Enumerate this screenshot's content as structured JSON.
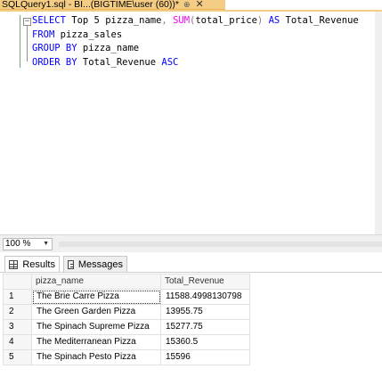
{
  "document_tab": {
    "title": "SQLQuery1.sql - BI...(BIGTIME\\user (60))*",
    "pin_glyph": "⊕",
    "close_glyph": "✕"
  },
  "editor": {
    "outline_toggle": "−",
    "lines": [
      [
        {
          "t": "SELECT",
          "c": "kw"
        },
        {
          "t": " Top 5 pizza_name",
          "c": "id"
        },
        {
          "t": ",",
          "c": "op"
        },
        {
          "t": " ",
          "c": "id"
        },
        {
          "t": "SUM",
          "c": "fn"
        },
        {
          "t": "(",
          "c": "op"
        },
        {
          "t": "total_price",
          "c": "id"
        },
        {
          "t": ")",
          "c": "op"
        },
        {
          "t": " ",
          "c": "id"
        },
        {
          "t": "AS",
          "c": "kw"
        },
        {
          "t": " Total_Revenue",
          "c": "id"
        }
      ],
      [
        {
          "t": "FROM",
          "c": "kw"
        },
        {
          "t": " pizza_sales",
          "c": "id"
        }
      ],
      [
        {
          "t": "GROUP BY",
          "c": "kw"
        },
        {
          "t": " pizza_name",
          "c": "id"
        }
      ],
      [
        {
          "t": "ORDER BY",
          "c": "kw"
        },
        {
          "t": " Total_Revenue ",
          "c": "id"
        },
        {
          "t": "ASC",
          "c": "kw"
        }
      ]
    ]
  },
  "zoom": {
    "value": "100 %",
    "arrow": "▼"
  },
  "result_tabs": {
    "results_label": "Results",
    "messages_label": "Messages"
  },
  "grid": {
    "columns": [
      "pizza_name",
      "Total_Revenue"
    ],
    "rows": [
      {
        "num": "1",
        "pizza_name": "The Brie Carre Pizza",
        "total_revenue": "11588.4998130798"
      },
      {
        "num": "2",
        "pizza_name": "The Green Garden Pizza",
        "total_revenue": "13955.75"
      },
      {
        "num": "3",
        "pizza_name": "The Spinach Supreme Pizza",
        "total_revenue": "15277.75"
      },
      {
        "num": "4",
        "pizza_name": "The Mediterranean Pizza",
        "total_revenue": "15360.5"
      },
      {
        "num": "5",
        "pizza_name": "The Spinach Pesto Pizza",
        "total_revenue": "15596"
      }
    ]
  },
  "colors": {
    "tab_accent": "#f5cc84",
    "keyword": "#0000ff",
    "function": "#ff00ff",
    "operator": "#808080"
  }
}
